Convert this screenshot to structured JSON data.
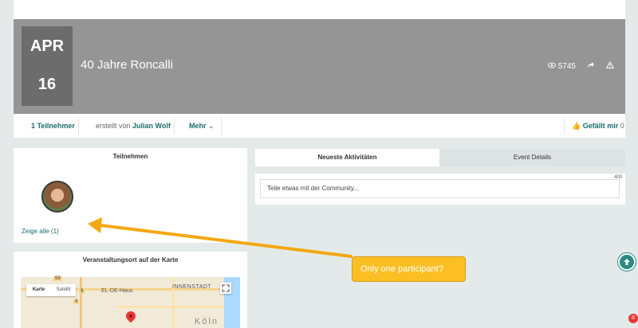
{
  "event": {
    "month": "APR",
    "day": "16",
    "title": "40 Jahre Roncalli",
    "views": "5745"
  },
  "meta": {
    "participants": "1 Teilnehmer",
    "created_by_prefix": "erstellt von",
    "author": "Julian Wolf",
    "more": "Mehr",
    "like": "Gefällt mir",
    "like_count": "0"
  },
  "participate_panel": {
    "title": "Teilnehmen",
    "show_all": "Zeige alle (1)"
  },
  "tabs": {
    "activity": "Neueste Aktivitäten",
    "details": "Event Details"
  },
  "composer": {
    "counter": "400",
    "placeholder": "Teile etwas mit der Community..."
  },
  "map_panel": {
    "title": "Veranstaltungsort auf der Karte",
    "map_type_map": "Karte",
    "map_type_satellite": "Satellit",
    "label_el_de_haus": "EL-DE-Haus",
    "label_innenstadt": "INNENSTADT",
    "label_koln": "Köln",
    "label_route_59": "59",
    "label_route_9": "9",
    "label_route_4": "4"
  },
  "annotation": {
    "text": "Only one participant?",
    "color": "#fbbf24"
  },
  "notifications": {
    "count": "8"
  },
  "colors": {
    "accent": "#1b6b6b",
    "banner": "#959595",
    "date_box": "#6c6c6c"
  }
}
